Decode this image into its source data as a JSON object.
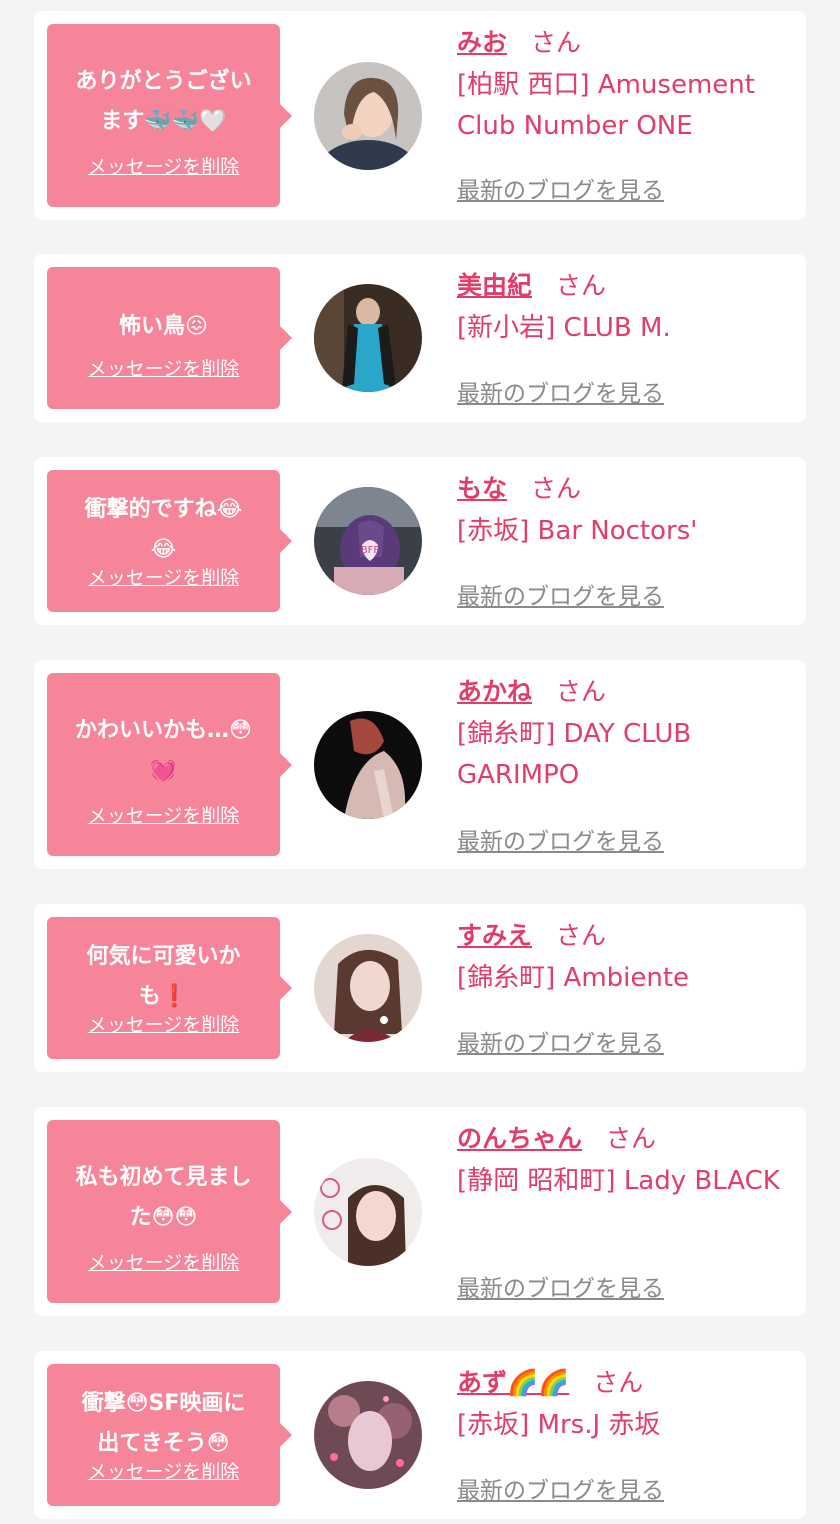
{
  "delete_label": "メッセージを削除",
  "blog_label": "最新のブログを見る",
  "colors": {
    "bubble": "#f7859a",
    "accent": "#e23c68",
    "blog_link": "#8a8a8a",
    "background": "#f4f4f4"
  },
  "entries": [
    {
      "message": "ありがとうござい\nます🐳🐳🤍",
      "name": "みお",
      "honorific": "さん",
      "shop": "[柏駅 西口] Amusement Club Number ONE"
    },
    {
      "message": "怖い鳥😖",
      "name": "美由紀",
      "honorific": "さん",
      "shop": "[新小岩] CLUB M."
    },
    {
      "message": "衝撃的ですね😂\n😂",
      "name": "もな",
      "honorific": "さん",
      "shop": "[赤坂] Bar Noctors'"
    },
    {
      "message": "かわいいかも…😳\n💓",
      "name": "あかね",
      "honorific": "さん",
      "shop": "[錦糸町] DAY CLUB GARIMPO"
    },
    {
      "message": "何気に可愛いか\nも❗️",
      "name": "すみえ",
      "honorific": "さん",
      "shop": "[錦糸町] Ambiente"
    },
    {
      "message": "私も初めて見まし\nた😳😳",
      "name": "のんちゃん",
      "honorific": "さん",
      "shop": "[静岡 昭和町] Lady BLACK"
    },
    {
      "message": "衝撃😳SF映画に\n出てきそう😳",
      "name": "あず🌈🌈",
      "honorific": "さん",
      "shop": "[赤坂] Mrs.J 赤坂"
    }
  ]
}
